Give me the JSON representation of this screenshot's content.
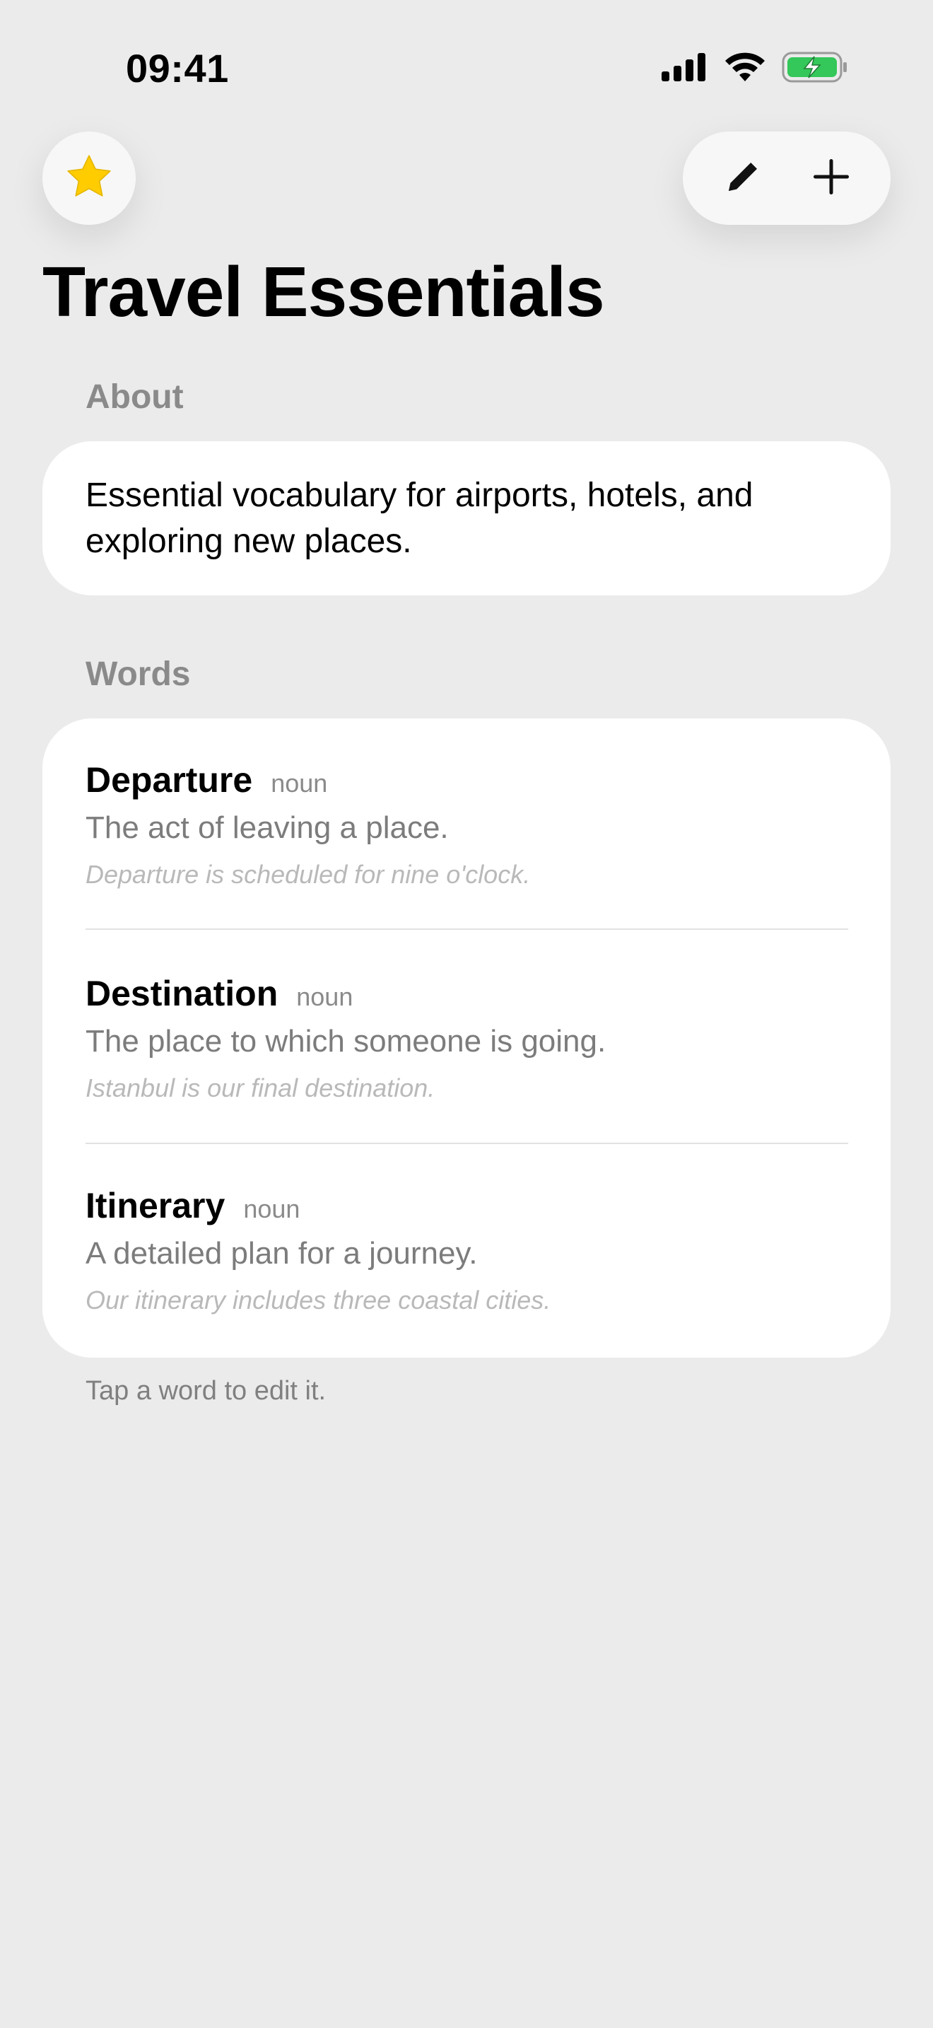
{
  "status_bar": {
    "time": "09:41",
    "signal_icon": "cellular-signal-icon",
    "wifi_icon": "wifi-icon",
    "battery_icon": "battery-charging-icon",
    "battery_color": "#34c759"
  },
  "toolbar": {
    "favorite_icon": "star-icon",
    "favorite_color": "#ffcc00",
    "edit_icon": "pencil-icon",
    "add_icon": "plus-icon"
  },
  "page": {
    "title": "Travel Essentials"
  },
  "about": {
    "header": "About",
    "text": "Essential vocabulary for airports, hotels, and exploring new places."
  },
  "words": {
    "header": "Words",
    "items": [
      {
        "term": "Departure",
        "part_of_speech": "noun",
        "definition": "The act of leaving a place.",
        "example": "Departure is scheduled for nine o'clock."
      },
      {
        "term": "Destination",
        "part_of_speech": "noun",
        "definition": "The place to which someone is going.",
        "example": "Istanbul is our final destination."
      },
      {
        "term": "Itinerary",
        "part_of_speech": "noun",
        "definition": "A detailed plan for a journey.",
        "example": "Our itinerary includes three coastal cities."
      }
    ],
    "footer": "Tap a word to edit it."
  }
}
